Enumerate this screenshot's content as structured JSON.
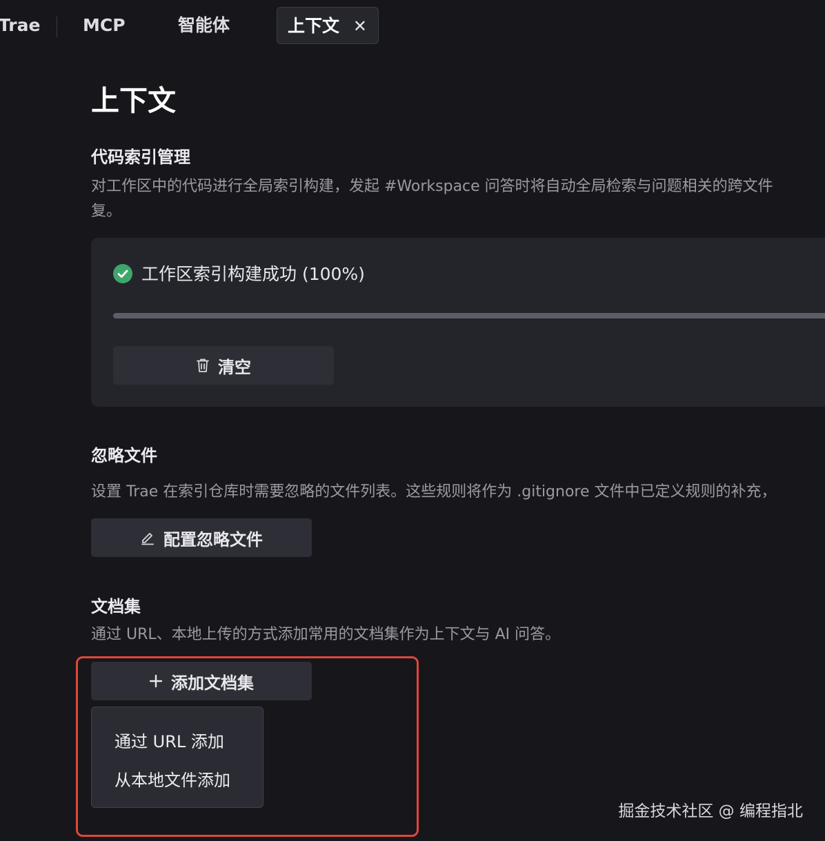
{
  "tabs": [
    {
      "label": "Trae",
      "active": false
    },
    {
      "label": "MCP",
      "active": false
    },
    {
      "label": "智能体",
      "active": false
    },
    {
      "label": "上下文",
      "active": true,
      "close_glyph": "✕"
    }
  ],
  "page": {
    "title": "上下文"
  },
  "code_index": {
    "title": "代码索引管理",
    "description_line1": "对工作区中的代码进行全局索引构建，发起 #Workspace 问答时将自动全局检索与问题相关的跨文件",
    "description_line2": "复。",
    "status_text": "工作区索引构建成功 (100%)",
    "status_icon": "check-circle-icon",
    "status_color": "#3fa66b",
    "progress": 1.0,
    "clear_label": "清空",
    "clear_icon": "trash-icon"
  },
  "ignore_files": {
    "title": "忽略文件",
    "description": "设置 Trae 在索引仓库时需要忽略的文件列表。这些规则将作为 .gitignore 文件中已定义规则的补充，",
    "configure_label": "配置忽略文件",
    "configure_icon": "pencil-icon"
  },
  "doc_sets": {
    "title": "文档集",
    "description": "通过 URL、本地上传的方式添加常用的文档集作为上下文与 AI 问答。",
    "add_label": "添加文档集",
    "add_icon": "plus-icon",
    "menu_items": [
      "通过 URL 添加",
      "从本地文件添加"
    ]
  },
  "highlight_color": "#e0473a",
  "watermark": "掘金技术社区 @ 编程指北"
}
